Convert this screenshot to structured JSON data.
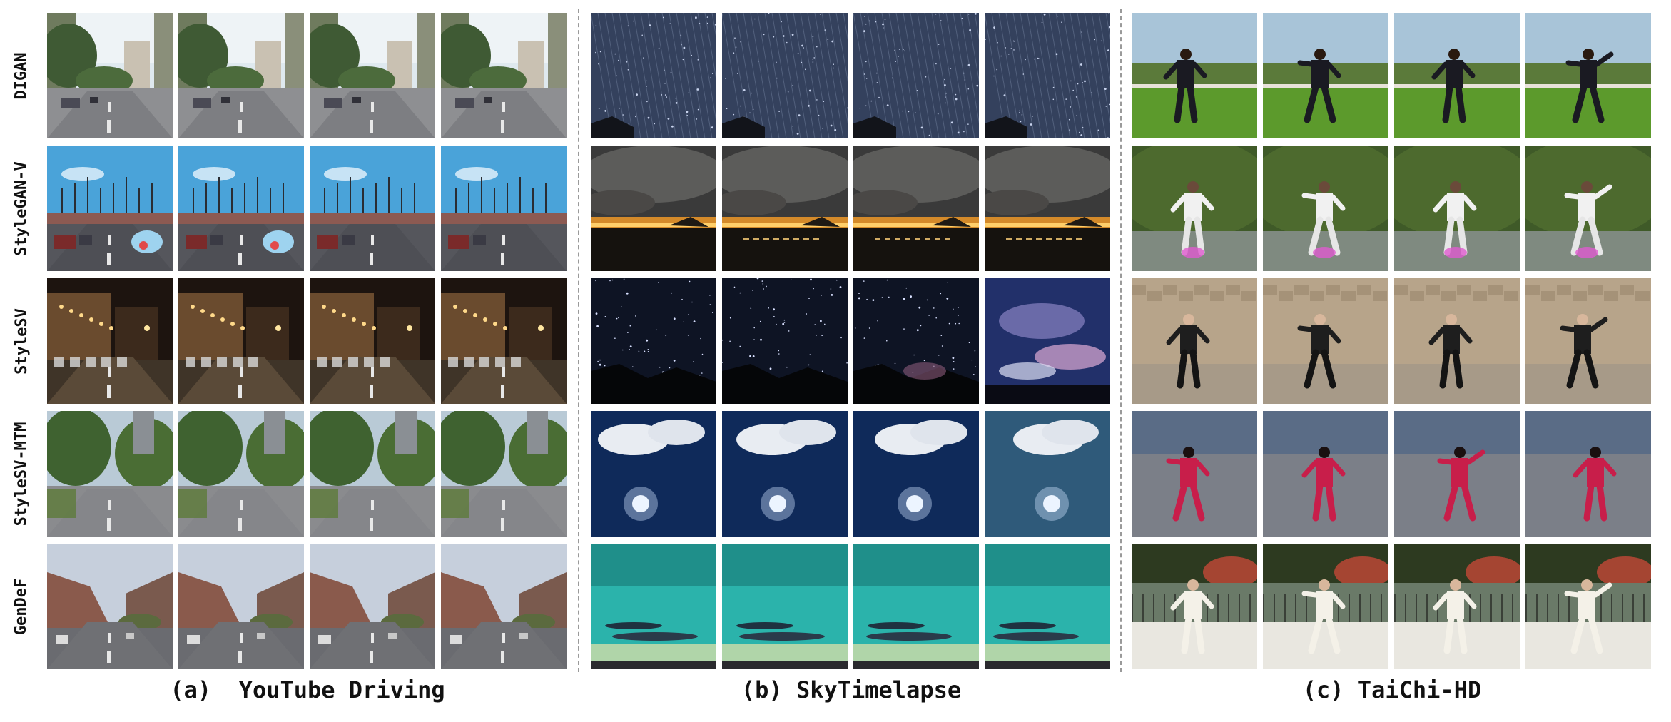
{
  "figure": {
    "methods": [
      "DIGAN",
      "StyleGAN-V",
      "StyleSV",
      "StyleSV-MTM",
      "GenDeF"
    ],
    "datasets": [
      {
        "key": "youtube",
        "caption": "(a)  YouTube Driving"
      },
      {
        "key": "sky",
        "caption": "(b) SkyTimelapse"
      },
      {
        "key": "taichi",
        "caption": "(c) TaiChi-HD"
      }
    ],
    "frames_per_method": 4
  },
  "scenes": {
    "youtube": [
      "street-day-buildings",
      "street-blue-sky-cars",
      "street-night-lights",
      "street-trees-road",
      "road-rocky-hills"
    ],
    "sky": [
      "starry-night-streaks",
      "sunset-clouds-horizon",
      "starry-night-mountains",
      "clouds-sun-flare",
      "teal-sky-clouds"
    ],
    "taichi": [
      "taichi-black-on-grass",
      "taichi-white-in-garden",
      "taichi-black-stone-wall",
      "taichi-red-on-road",
      "taichi-white-by-fence"
    ]
  },
  "colors": {
    "divider": "#9a9a9a",
    "text": "#111111"
  }
}
